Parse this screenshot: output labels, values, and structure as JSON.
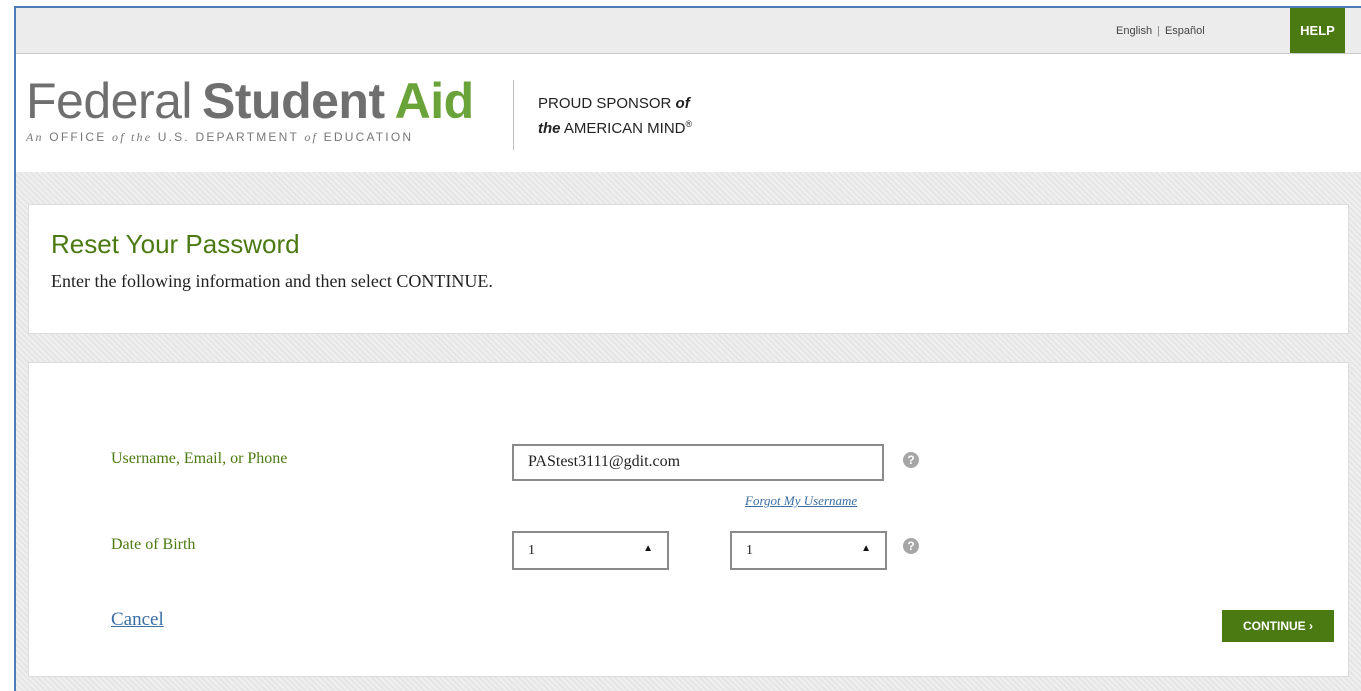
{
  "topbar": {
    "lang_english": "English",
    "lang_separator": "|",
    "lang_espanol": "Español",
    "help_label": "HELP"
  },
  "header": {
    "logo_word1": "Federal",
    "logo_word2": "Student",
    "logo_word3": "Aid",
    "logo_sub_a": "An",
    "logo_sub_b": "OFFICE",
    "logo_sub_c": "of the",
    "logo_sub_d": "U.S. DEPARTMENT",
    "logo_sub_e": "of",
    "logo_sub_f": "EDUCATION",
    "sponsor_line1": "PROUD SPONSOR",
    "sponsor_of": "of",
    "sponsor_the": "the",
    "sponsor_line2": "AMERICAN MIND",
    "sponsor_mark": "®"
  },
  "intro": {
    "title": "Reset Your Password",
    "instruction": "Enter the following information and then select CONTINUE."
  },
  "form": {
    "username_label": "Username, Email, or Phone",
    "username_value": "PAStest3111@gdit.com",
    "forgot_link": "Forgot My Username",
    "dob_label": "Date of Birth",
    "dob_month_value": "1",
    "dob_day_value": "1",
    "help_icon_glyph": "?",
    "select_arrow_glyph": "▲",
    "cancel_label": "Cancel",
    "continue_label": "CONTINUE ›"
  },
  "colors": {
    "brand_green": "#4c7a12",
    "logo_green": "#6aa33a",
    "link_blue": "#3a6ea5"
  }
}
